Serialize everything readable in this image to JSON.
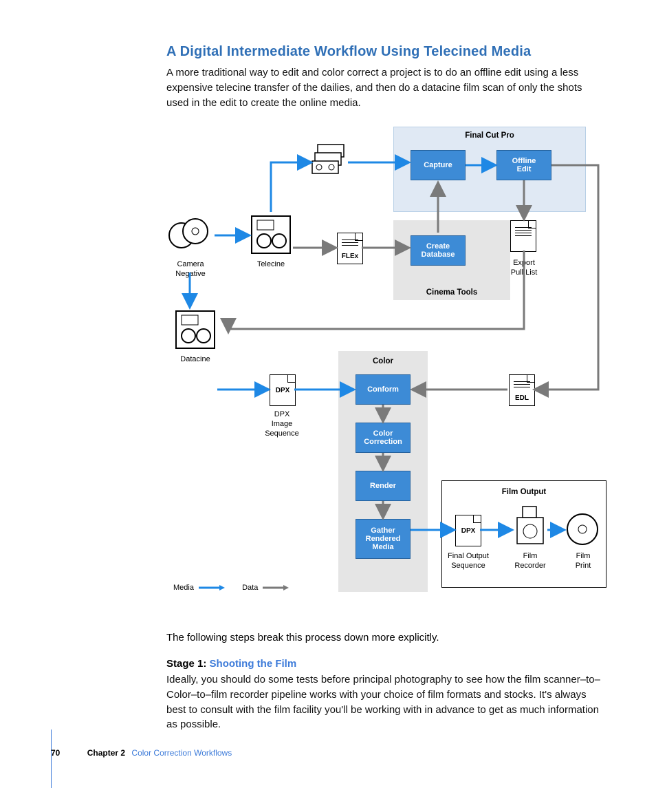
{
  "heading": "A Digital Intermediate Workflow Using Telecined Media",
  "intro": "A more traditional way to edit and color correct a project is to do an offline edit using a less expensive telecine transfer of the dailies, and then do a datacine film scan of only the shots used in the edit to create the online media.",
  "followup": "The following steps break this process down more explicitly.",
  "stage": {
    "prefix": "Stage 1: ",
    "name": "Shooting the Film"
  },
  "stage_body": "Ideally, you should do some tests before principal photography to see how the film scanner–to–Color–to–film recorder pipeline works with your choice of film formats and stocks. It's always best to consult with the film facility you'll be working with in advance to get as much information as possible.",
  "diagram": {
    "groups": {
      "fcp": "Final Cut Pro",
      "ct": "Cinema Tools",
      "color": "Color",
      "film": "Film Output"
    },
    "nodes": {
      "capture": "Capture",
      "offline_edit": "Offline\nEdit",
      "create_db": "Create\nDatabase",
      "conform": "Conform",
      "cc": "Color\nCorrection",
      "render": "Render",
      "gather": "Gather\nRendered\nMedia"
    },
    "labels": {
      "camneg": "Camera\nNegative",
      "telecine": "Telecine",
      "flex": "FLEx",
      "export_pull": "Export\nPull List",
      "datacine": "Datacine",
      "dpx": "DPX",
      "dpx_seq": "DPX\nImage\nSequence",
      "edl": "EDL",
      "final_seq": "Final Output\nSequence",
      "film_rec": "Film\nRecorder",
      "film_print": "Film\nPrint"
    },
    "legend": {
      "media": "Media",
      "data": "Data"
    }
  },
  "footer": {
    "page": "70",
    "chapter": "Chapter 2",
    "title": "Color Correction Workflows"
  }
}
